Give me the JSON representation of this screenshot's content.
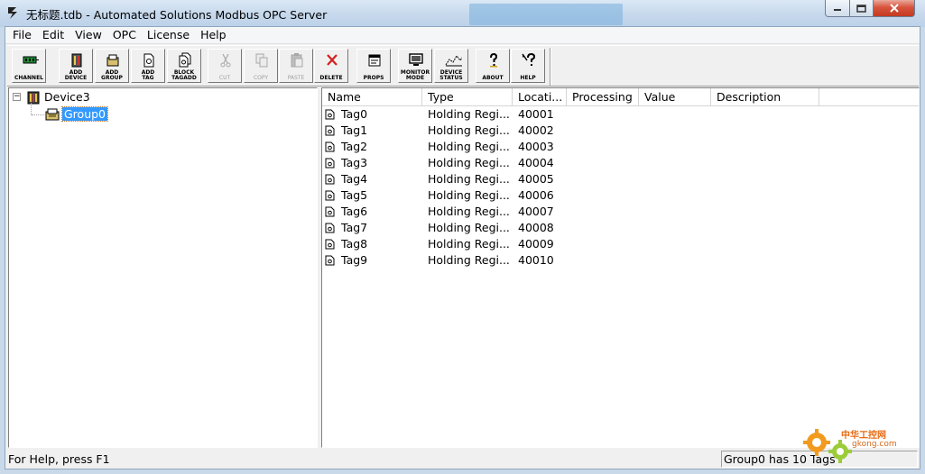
{
  "window": {
    "title": "无标题.tdb - Automated Solutions Modbus OPC Server"
  },
  "menu": [
    "File",
    "Edit",
    "View",
    "OPC",
    "License",
    "Help"
  ],
  "toolbar": {
    "buttons": [
      {
        "label": "CHANNEL",
        "icon": "channel-icon",
        "enabled": true
      },
      {
        "label": "ADD\nDEVICE",
        "icon": "add-device-icon",
        "enabled": true
      },
      {
        "label": "ADD\nGROUP",
        "icon": "add-group-icon",
        "enabled": true
      },
      {
        "label": "ADD\nTAG",
        "icon": "add-tag-icon",
        "enabled": true
      },
      {
        "label": "BLOCK\nTAGADD",
        "icon": "block-tag-add-icon",
        "enabled": true
      },
      {
        "label": "CUT",
        "icon": "cut-icon",
        "enabled": false
      },
      {
        "label": "COPY",
        "icon": "copy-icon",
        "enabled": false
      },
      {
        "label": "PASTE",
        "icon": "paste-icon",
        "enabled": false
      },
      {
        "label": "DELETE",
        "icon": "delete-icon",
        "enabled": true
      },
      {
        "label": "PROPS",
        "icon": "properties-icon",
        "enabled": true
      },
      {
        "label": "MONITOR\nMODE",
        "icon": "monitor-icon",
        "enabled": true
      },
      {
        "label": "DEVICE\nSTATUS",
        "icon": "device-status-icon",
        "enabled": true
      },
      {
        "label": "ABOUT",
        "icon": "about-icon",
        "enabled": true
      },
      {
        "label": "HELP",
        "icon": "help-icon",
        "enabled": true
      }
    ]
  },
  "tree": {
    "device": "Device3",
    "group": "Group0",
    "expander": "−"
  },
  "list": {
    "columns": [
      "Name",
      "Type",
      "Locati...",
      "Processing",
      "Value",
      "Description"
    ],
    "rows": [
      {
        "name": "Tag0",
        "type": "Holding Regi...",
        "location": "40001"
      },
      {
        "name": "Tag1",
        "type": "Holding Regi...",
        "location": "40002"
      },
      {
        "name": "Tag2",
        "type": "Holding Regi...",
        "location": "40003"
      },
      {
        "name": "Tag3",
        "type": "Holding Regi...",
        "location": "40004"
      },
      {
        "name": "Tag4",
        "type": "Holding Regi...",
        "location": "40005"
      },
      {
        "name": "Tag5",
        "type": "Holding Regi...",
        "location": "40006"
      },
      {
        "name": "Tag6",
        "type": "Holding Regi...",
        "location": "40007"
      },
      {
        "name": "Tag7",
        "type": "Holding Regi...",
        "location": "40008"
      },
      {
        "name": "Tag8",
        "type": "Holding Regi...",
        "location": "40009"
      },
      {
        "name": "Tag9",
        "type": "Holding Regi...",
        "location": "40010"
      }
    ]
  },
  "status": {
    "help": "For Help, press F1",
    "summary": "Group0 has 10 Tags"
  },
  "watermark": {
    "brand": "中华工控网",
    "site": "gkong.com"
  },
  "colors": {
    "selection": "#3399ff",
    "close_button": "#c23a22",
    "watermark": "#e86a12"
  }
}
